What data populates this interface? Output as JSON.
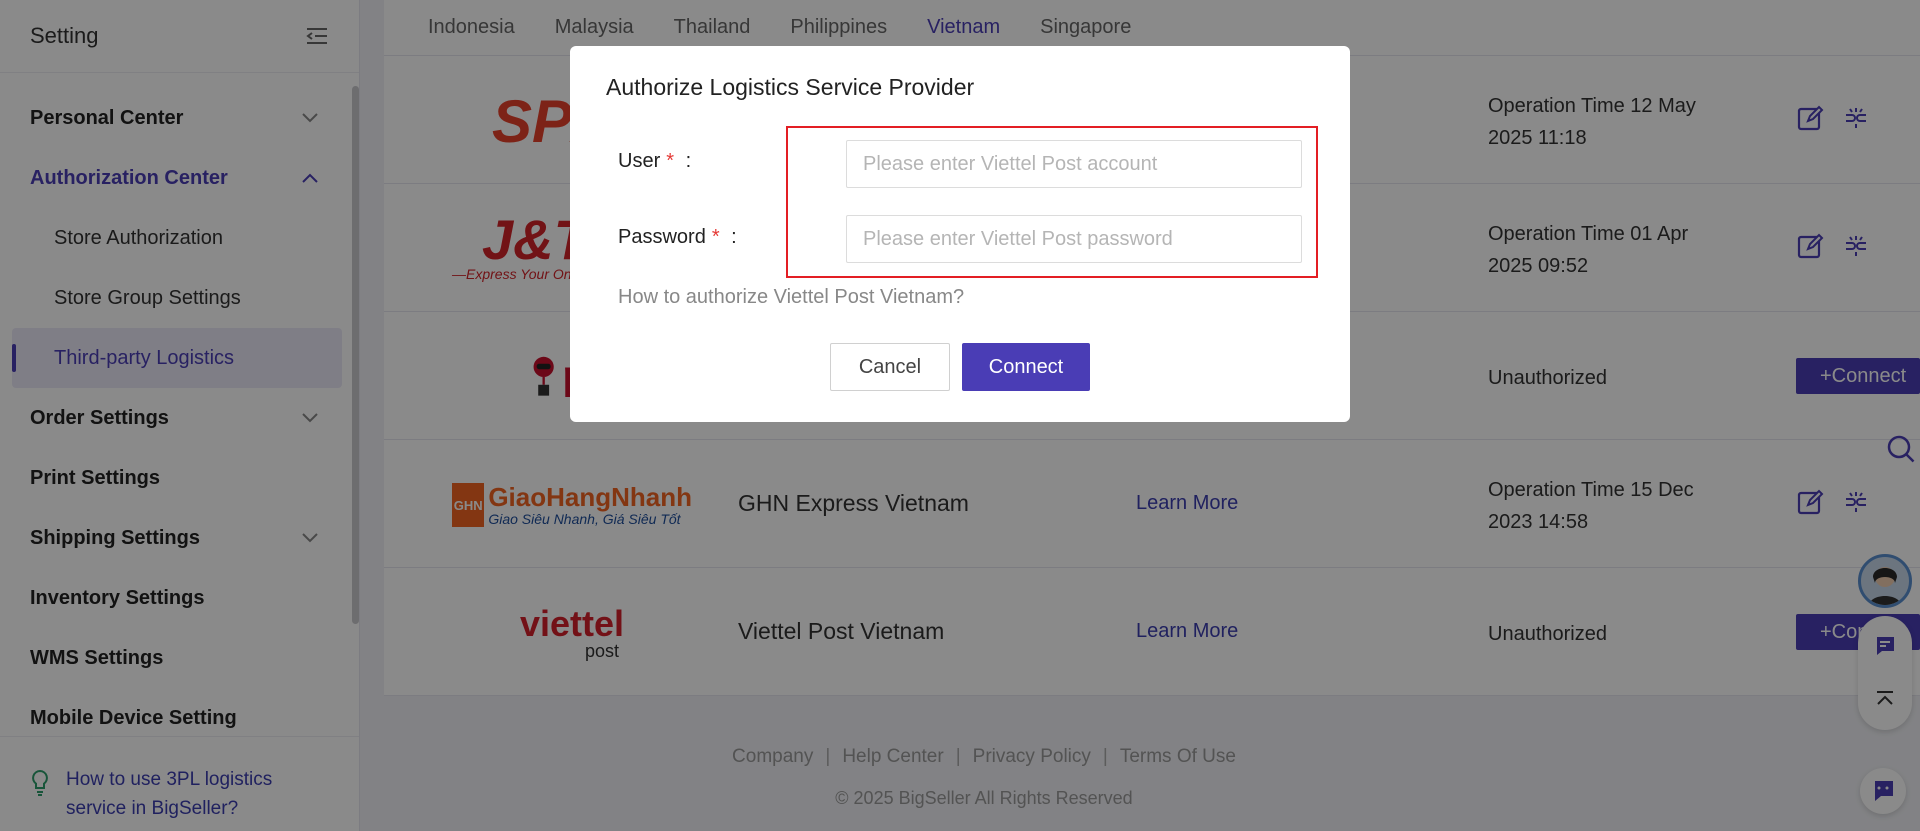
{
  "sidebar": {
    "title": "Setting",
    "menu": [
      {
        "label": "Personal Center",
        "expandable": true
      },
      {
        "label": "Authorization Center",
        "expandable": true,
        "open": true
      },
      {
        "label": "Order Settings",
        "expandable": true
      },
      {
        "label": "Print Settings"
      },
      {
        "label": "Shipping Settings",
        "expandable": true
      },
      {
        "label": "Inventory Settings"
      },
      {
        "label": "WMS Settings"
      },
      {
        "label": "Mobile Device Setting"
      }
    ],
    "sub_items": [
      "Store Authorization",
      "Store Group Settings",
      "Third-party Logistics"
    ],
    "help_link": "How to use 3PL logistics service in BigSeller?"
  },
  "tabs": {
    "items": [
      "Indonesia",
      "Malaysia",
      "Thailand",
      "Philippines",
      "Vietnam",
      "Singapore"
    ],
    "active": "Vietnam"
  },
  "providers": [
    {
      "logo_text": "SPX",
      "name": "",
      "learn_more": "",
      "status": "Operation Time 12 May 2025 11:18",
      "authorized": true
    },
    {
      "logo_text": "J&T",
      "logo_sub": "—Express Your Online Business",
      "name": "",
      "learn_more": "",
      "status": "Operation Time 01 Apr 2025 09:52",
      "authorized": true
    },
    {
      "logo_text": "ninja",
      "name": "",
      "learn_more": "",
      "status": "Unauthorized",
      "authorized": false,
      "connect_label": "+Connect"
    },
    {
      "logo_text": "GiaoHangNhanh",
      "logo_sub": "Giao Siêu Nhanh, Giá Siêu Tốt",
      "logo_badge": "GHN",
      "name": "GHN Express Vietnam",
      "learn_more": "Learn More",
      "status": "Operation Time 15 Dec 2023 14:58",
      "authorized": true
    },
    {
      "logo_text": "viettel",
      "logo_sub": "post",
      "name": "Viettel Post Vietnam",
      "learn_more": "Learn More",
      "status": "Unauthorized",
      "authorized": false,
      "connect_label": "+Connect"
    }
  ],
  "footer": {
    "links": [
      "Company",
      "Help Center",
      "Privacy Policy",
      "Terms Of Use"
    ],
    "copyright": "© 2025 BigSeller All Rights Reserved"
  },
  "modal": {
    "title": "Authorize Logistics Service Provider",
    "user_label": "User",
    "password_label": "Password",
    "required_mark": "*",
    "colon": ":",
    "user_placeholder": "Please enter Viettel Post account",
    "password_placeholder": "Please enter Viettel Post password",
    "how_link": "How to authorize Viettel Post Vietnam?",
    "cancel": "Cancel",
    "connect": "Connect"
  },
  "colors": {
    "accent": "#4a3db5",
    "required": "#e53935",
    "highlight": "#e31e24"
  }
}
